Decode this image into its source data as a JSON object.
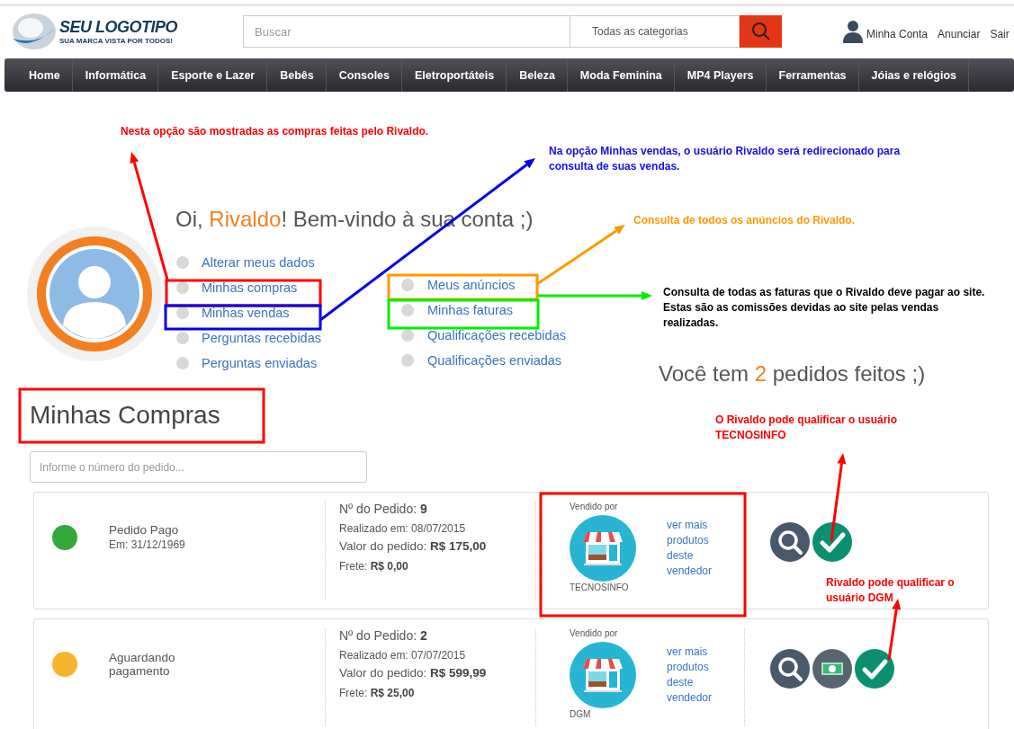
{
  "header": {
    "logo": {
      "title": "SEU LOGOTIPO",
      "tagline": "SUA MARCA VISTA POR TODOS!"
    },
    "search": {
      "placeholder": "Buscar"
    },
    "category": "Todas as categorias",
    "account_links": [
      "Minha Conta",
      "Anunciar",
      "Sair"
    ]
  },
  "nav": [
    "Home",
    "Informática",
    "Esporte e Lazer",
    "Bebês",
    "Consoles",
    "Eletroportáteis",
    "Beleza",
    "Moda Feminina",
    "MP4 Players",
    "Ferramentas",
    "Jóias e relógios"
  ],
  "welcome": {
    "greeting": "Oi, ",
    "name": "Rivaldo",
    "rest": "! Bem-vindo à sua conta ;)"
  },
  "menu_left": [
    "Alterar meus dados",
    "Minhas compras",
    "Minhas vendas",
    "Perguntas recebidas",
    "Perguntas enviadas"
  ],
  "menu_right": [
    "Meus anúncios",
    "Minhas faturas",
    "Qualificações recebidas",
    "Qualificações enviadas"
  ],
  "orders_summary": {
    "before": "Você tem ",
    "count": "2",
    "after": " pedidos feitos ;)"
  },
  "section_title": "Minhas Compras",
  "order_search": {
    "placeholder": "Informe o número do pedido..."
  },
  "orders": [
    {
      "status": "Pedido Pago",
      "status_date": "Em: 31/12/1969",
      "color": "#34a93a",
      "number": "Nº do Pedido: **9**",
      "placed": "Realizado em: 08/07/2015",
      "value": "Valor do pedido: **R$ 175,00**",
      "freight": "Frete: **R$ 0,00**",
      "sold_by": "Vendido por",
      "seller": "TECNOSINFO",
      "seller_link": "ver mais produtos deste vendedor",
      "actions": [
        {
          "kind": "search"
        },
        {
          "kind": "rate"
        }
      ]
    },
    {
      "status": "Aguardando pagamento",
      "color": "#f5b52e",
      "number": "Nº do Pedido: **2**",
      "placed": "Realizado em: 07/07/2015",
      "value": "Valor do pedido: **R$ 599,99**",
      "freight": "Frete: **R$ 25,00**",
      "sold_by": "Vendido por",
      "seller": "DGM",
      "seller_link": "ver mais produtos deste vendedor",
      "actions": [
        {
          "kind": "search"
        },
        {
          "kind": "pay"
        },
        {
          "kind": "rate"
        }
      ]
    }
  ],
  "annotations": [
    {
      "text": "Nesta opção são mostradas as compras feitas pelo Rivaldo.",
      "color": "#ff0000"
    },
    {
      "text": "Na opção Minhas vendas, o usuário Rivaldo será redirecionado para consulta de suas vendas.",
      "color": "#1010ee"
    },
    {
      "text": "Consulta de todos os anúncios do Rivaldo.",
      "color": "#ff9900"
    },
    {
      "text": "Consulta de todas as faturas que o Rivaldo deve pagar ao site. Estas são as comissões devidas ao site pelas vendas realizadas.",
      "color": "#000000"
    },
    {
      "text": "O Rivaldo pode qualificar o usuário TECNOSINFO",
      "color": "#ff0000"
    },
    {
      "text": "Rivaldo pode qualificar o usuário DGM",
      "color": "#ff0000"
    }
  ],
  "frames": [
    {
      "color": "#ff0000"
    },
    {
      "color": "#0000ee"
    },
    {
      "color": "#ff9900"
    },
    {
      "color": "#00ee00"
    },
    {
      "color": "#ff0000"
    },
    {
      "color": "#ff0000"
    }
  ],
  "arrows": [
    {
      "color": "#ff0000"
    },
    {
      "color": "#0000ee"
    },
    {
      "color": "#ff9900"
    },
    {
      "color": "#00ee00"
    },
    {
      "color": "#ff0000"
    },
    {
      "color": "#ff0000"
    }
  ]
}
